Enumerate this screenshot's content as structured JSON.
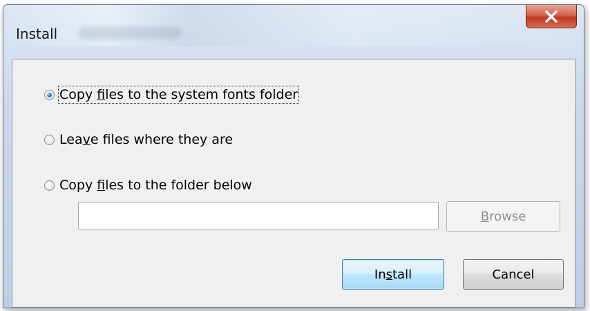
{
  "window": {
    "title": "Install",
    "close_glyph": "X"
  },
  "options": [
    {
      "pre": "Copy ",
      "u": "f",
      "post": "iles to the system fonts folder",
      "checked": true,
      "focused": true
    },
    {
      "pre": "Lea",
      "u": "v",
      "post": "e files where they are",
      "checked": false,
      "focused": false
    },
    {
      "pre": "Copy ",
      "u": "f",
      "post": "iles to the folder below",
      "checked": false,
      "focused": false
    }
  ],
  "folder_input": {
    "value": "",
    "placeholder": ""
  },
  "buttons": {
    "browse": {
      "u": "B",
      "post": "rowse",
      "enabled": false
    },
    "install": {
      "pre": "In",
      "u": "s",
      "post": "tall"
    },
    "cancel": {
      "label": "Cancel"
    }
  },
  "icons": {
    "close": "close-icon",
    "radio_checked": "radio-checked-icon",
    "radio_unchecked": "radio-unchecked-icon"
  }
}
